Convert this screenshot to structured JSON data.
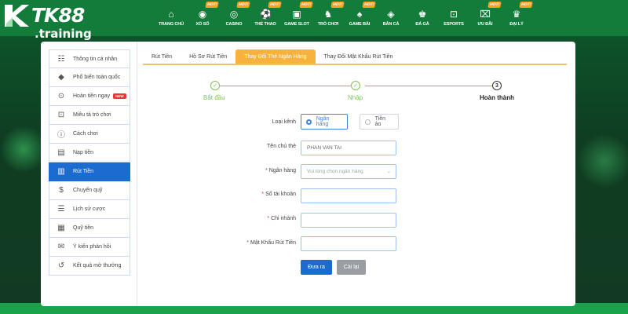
{
  "brand": {
    "name": "TK88",
    "domain": ".training"
  },
  "nav": [
    {
      "label": "TRANG CHỦ",
      "icon": "home-icon",
      "hot": false
    },
    {
      "label": "XỔ SỐ",
      "icon": "lottery-icon",
      "hot": true
    },
    {
      "label": "CASINO",
      "icon": "casino-chip-icon",
      "hot": true
    },
    {
      "label": "THỂ THAO",
      "icon": "sports-icon",
      "hot": true
    },
    {
      "label": "GAME SLOT",
      "icon": "slot-icon",
      "hot": true
    },
    {
      "label": "TRÒ CHƠI",
      "icon": "chess-icon",
      "hot": true
    },
    {
      "label": "GAME BÀI",
      "icon": "cards-icon",
      "hot": true
    },
    {
      "label": "BẮN CÁ",
      "icon": "fish-icon",
      "hot": false
    },
    {
      "label": "ĐÁ GÀ",
      "icon": "rooster-icon",
      "hot": false
    },
    {
      "label": "ESPORTS",
      "icon": "gamepad-icon",
      "hot": false
    },
    {
      "label": "ƯU ĐÃI",
      "icon": "gift-icon",
      "hot": true
    },
    {
      "label": "ĐẠI LÝ",
      "icon": "agent-icon",
      "hot": true
    }
  ],
  "hot_label": "HOT!",
  "sidebar": [
    {
      "label": "Thông tin cá nhân",
      "icon": "id-card-icon"
    },
    {
      "label": "Phổ biến toàn quốc",
      "icon": "diamond-icon"
    },
    {
      "label": "Hoàn tiền ngay",
      "icon": "cashback-icon",
      "badge": "NEW"
    },
    {
      "label": "Miêu tả trò chơi",
      "icon": "gamepad-icon"
    },
    {
      "label": "Cách chơi",
      "icon": "info-icon"
    },
    {
      "label": "Nạp tiền",
      "icon": "deposit-icon"
    },
    {
      "label": "Rút Tiền",
      "icon": "withdraw-icon",
      "active": true
    },
    {
      "label": "Chuyển quỹ",
      "icon": "transfer-icon"
    },
    {
      "label": "Lịch sử cược",
      "icon": "history-list-icon"
    },
    {
      "label": "Quỹ tiền",
      "icon": "wallet-icon"
    },
    {
      "label": "Ý kiến phản hồi",
      "icon": "feedback-icon"
    },
    {
      "label": "Kết quả mở thưởng",
      "icon": "clock-history-icon"
    }
  ],
  "tabs": [
    {
      "label": "Rút Tiền",
      "active": false
    },
    {
      "label": "Hồ Sơ Rút Tiền",
      "active": false
    },
    {
      "label": "Thay Đổi Thẻ Ngân Hàng",
      "active": true
    },
    {
      "label": "Thay Đổi Mật Khẩu Rút Tiền",
      "active": false
    }
  ],
  "steps": [
    {
      "label": "Bắt đầu",
      "marker": "✓",
      "state": "done"
    },
    {
      "label": "Nhập",
      "marker": "✓",
      "state": "done"
    },
    {
      "label": "Hoàn thành",
      "marker": "3",
      "state": "current"
    }
  ],
  "form": {
    "type_label": "Loại kênh",
    "type_options": [
      {
        "label": "Ngân hàng",
        "selected": true
      },
      {
        "label": "Tiền ảo",
        "selected": false
      }
    ],
    "holder_label": "Tên chủ thẻ",
    "holder_value": "PHAN VAN TAI",
    "bank_label": "Ngân hàng",
    "bank_placeholder": "Vui lòng chọn ngân hàng",
    "account_label": "Số tài khoản",
    "branch_label": "Chi nhánh",
    "password_label": "Mật Khẩu Rút Tiền",
    "submit_label": "Đưa ra",
    "reset_label": "Cài lại"
  },
  "colors": {
    "header": "#137c3a",
    "active": "#1c6bd0",
    "tab_active": "#f6b23c",
    "step_done": "#7cc35a",
    "hot_badge": "#f5a11b"
  }
}
